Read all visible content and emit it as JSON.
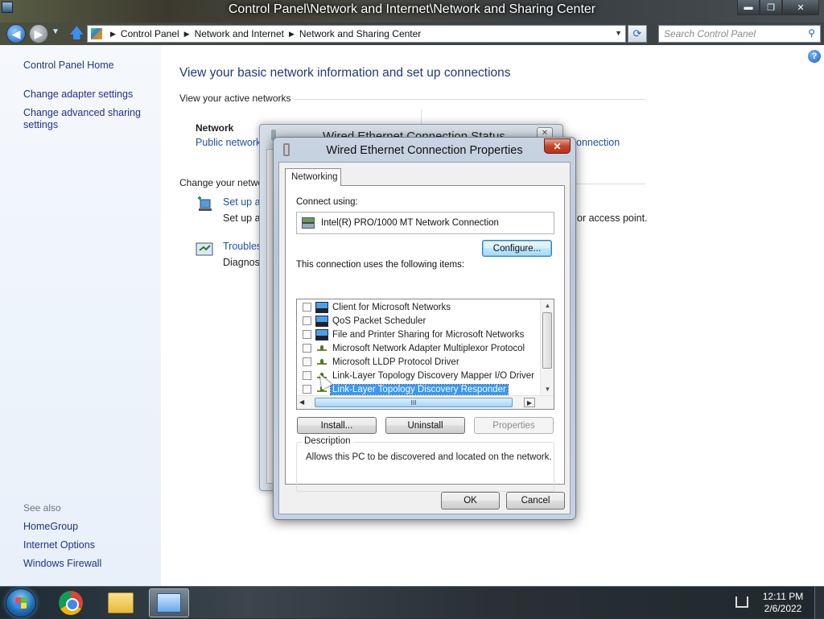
{
  "window": {
    "title": "Control Panel\\Network and Internet\\Network and Sharing Center",
    "min_glyph": "▬",
    "max_glyph": "❐",
    "close_glyph": "✕"
  },
  "address": {
    "crumbs": [
      "Control Panel",
      "Network and Internet",
      "Network and Sharing Center"
    ],
    "search_placeholder": "Search Control Panel"
  },
  "leftpane": {
    "home": "Control Panel Home",
    "links": [
      "Change adapter settings",
      "Change advanced sharing",
      "settings"
    ],
    "see_also_label": "See also",
    "see_also": [
      "HomeGroup",
      "Internet Options",
      "Windows Firewall"
    ]
  },
  "main": {
    "title": "View your basic network information and set up connections",
    "active_networks_label": "View your active networks",
    "network_name": "Network",
    "network_type": "Public network",
    "connection_link": "onnection",
    "change_settings_label": "Change your netwo",
    "setup_link": "Set up a",
    "setup_desc_left": "Set up a",
    "setup_desc_right": "or access point.",
    "troubleshoot_link": "Troubles",
    "troubleshoot_desc": "Diagnose"
  },
  "status_dialog": {
    "title": "Wired Ethernet Connection Status"
  },
  "properties_dialog": {
    "title": "Wired Ethernet Connection Properties",
    "close_glyph": "✕",
    "tab": "Networking",
    "connect_using_label": "Connect using:",
    "adapter": "Intel(R) PRO/1000 MT Network Connection",
    "configure_button": "Configure...",
    "items_label": "This connection uses the following items:",
    "items": [
      {
        "label": "Client for Microsoft Networks",
        "icon": "network-client-icon",
        "checked": false
      },
      {
        "label": "QoS Packet Scheduler",
        "icon": "network-service-icon",
        "checked": false
      },
      {
        "label": "File and Printer Sharing for Microsoft Networks",
        "icon": "network-service-icon",
        "checked": false
      },
      {
        "label": "Microsoft Network Adapter Multiplexor Protocol",
        "icon": "protocol-icon",
        "checked": false
      },
      {
        "label": "Microsoft LLDP Protocol Driver",
        "icon": "protocol-icon",
        "checked": false
      },
      {
        "label": "Link-Layer Topology Discovery Mapper I/O Driver",
        "icon": "protocol-icon",
        "checked": false
      },
      {
        "label": "Link-Layer Topology Discovery Responder",
        "icon": "protocol-icon",
        "checked": false,
        "selected": true
      }
    ],
    "install_button": "Install...",
    "uninstall_button": "Uninstall",
    "properties_button": "Properties",
    "description_label": "Description",
    "description": "Allows this PC to be discovered and located on the network.",
    "ok_button": "OK",
    "cancel_button": "Cancel",
    "hscroll_grip": "III"
  },
  "taskbar": {
    "time": "12:11 PM",
    "date": "2/6/2022"
  },
  "colors": {
    "link": "#1e50a0",
    "title": "#1e3c78",
    "selection": "#3399ff"
  }
}
